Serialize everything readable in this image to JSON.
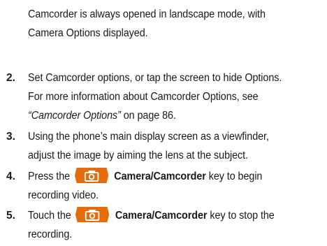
{
  "intro": {
    "lines": [
      "Camcorder is always opened in landscape mode, with",
      "Camera Options displayed."
    ]
  },
  "steps": [
    {
      "number": "2.",
      "line1": "Set Camcorder options, or tap the screen to hide Options.",
      "line2": "For more information about Camcorder Options, see",
      "line3_ref": "“Camcorder Options”",
      "line3_rest": " on page 86."
    },
    {
      "number": "3.",
      "line1": "Using the phone’s main display screen as a viewfinder,",
      "line2": "adjust the image by aiming the lens at the subject."
    },
    {
      "number": "4.",
      "before_key": "Press the",
      "key_label": "Camera/Camcorder",
      "after_key": " key to begin",
      "line2": "recording video.",
      "key_icon": "camera-icon"
    },
    {
      "number": "5.",
      "before_key": "Touch the",
      "key_label": "Camera/Camcorder",
      "after_key": " key to stop the",
      "line2": "recording.",
      "key_icon": "camera-icon"
    }
  ],
  "colors": {
    "text": "#1a1a1a",
    "keycap": "#e46c0a"
  }
}
